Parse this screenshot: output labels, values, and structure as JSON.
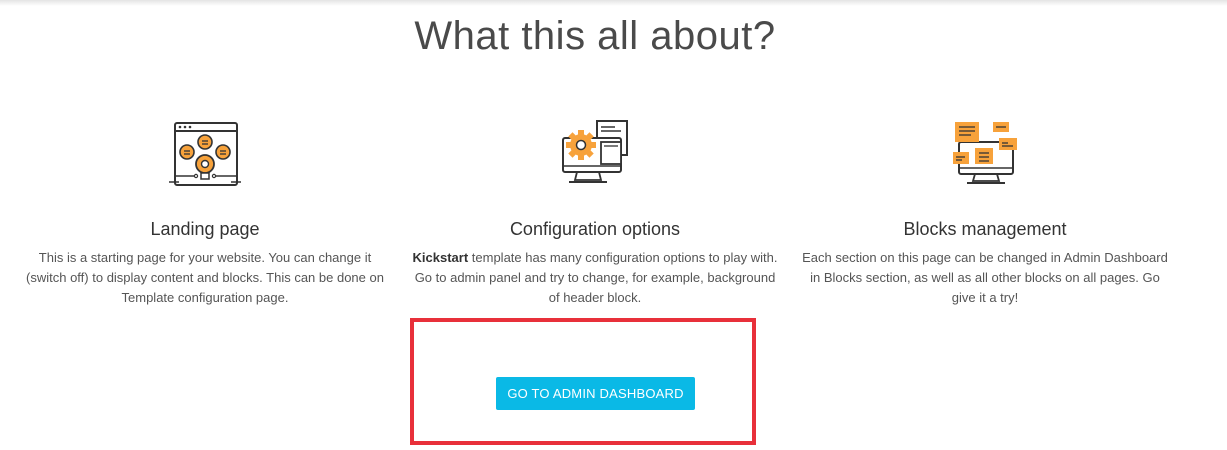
{
  "section": {
    "heading": "What this all about?"
  },
  "features": [
    {
      "icon": "lightbulb-ideas-icon",
      "title": "Landing page",
      "text": "This is a starting page for your website. You can change it (switch off) to display content and blocks. This can be done on Template configuration page."
    },
    {
      "icon": "gear-monitor-icon",
      "title": "Configuration options",
      "text_bold": "Kickstart",
      "text": " template has many configuration options to play with. Go to admin panel and try to change, for example, background of header block."
    },
    {
      "icon": "blocks-monitor-icon",
      "title": "Blocks management",
      "text": "Each section on this page can be changed in Admin Dashboard in Blocks section, as well as all other blocks on all pages. Go give it a try!"
    }
  ],
  "cta": {
    "label": "GO TO ADMIN DASHBOARD"
  },
  "colors": {
    "accent_orange": "#f7a23b",
    "button_blue": "#0ab9e6",
    "highlight_red": "#e8303a",
    "icon_stroke": "#333333"
  }
}
